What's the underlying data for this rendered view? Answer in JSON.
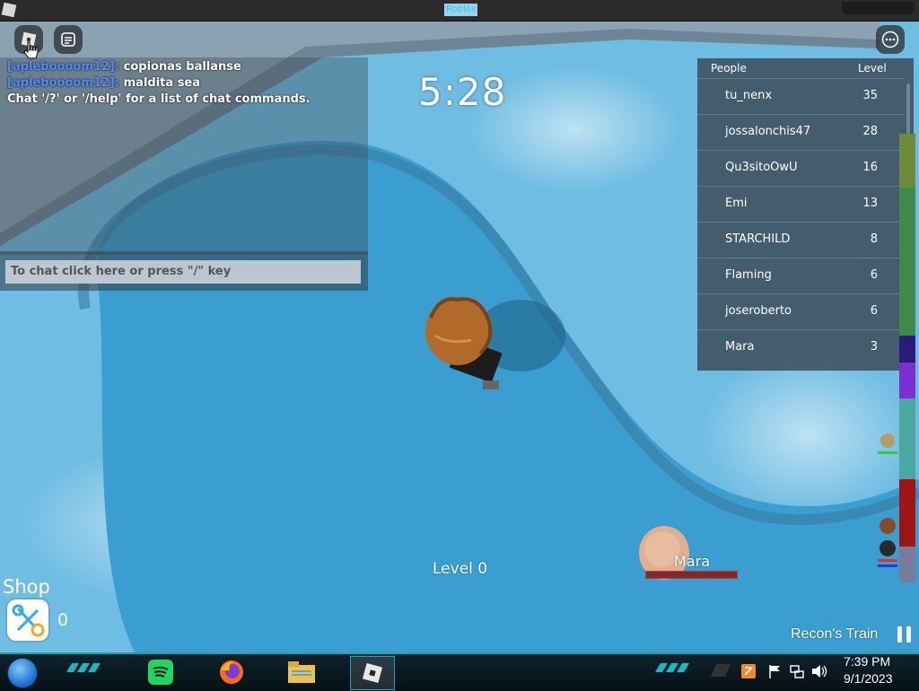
{
  "window": {
    "title": "Roblox"
  },
  "chat": {
    "messages": [
      {
        "name": "[apleboooom12]:",
        "text": "copionas ballanse"
      },
      {
        "name": "[apleboooom12]:",
        "text": "maldita sea"
      },
      {
        "name": "",
        "text": "Chat '/?' or '/help' for a list of chat commands."
      }
    ],
    "input_placeholder": "To chat click here or press \"/\" key"
  },
  "timer": "5:28",
  "leaderboard": {
    "header_people": "People",
    "header_level": "Level",
    "rows": [
      {
        "name": "tu_nenx",
        "level": "35"
      },
      {
        "name": "jossalonchis47",
        "level": "28"
      },
      {
        "name": "Qu3sitoOwU",
        "level": "16"
      },
      {
        "name": "Emi",
        "level": "13"
      },
      {
        "name": "STARCHILD",
        "level": "8"
      },
      {
        "name": "Flaming",
        "level": "6"
      },
      {
        "name": "joseroberto",
        "level": "6"
      },
      {
        "name": "Mara",
        "level": "3"
      }
    ]
  },
  "hud": {
    "level_label": "Level 0",
    "npc_name": "Mara",
    "shop_label": "Shop",
    "coins": "0",
    "train_label": "Recon's Train"
  },
  "taskbar": {
    "apps": [
      "spotify-icon",
      "firefox-icon",
      "file-explorer-icon",
      "roblox-icon"
    ],
    "time": "7:39 PM",
    "date": "9/1/2023"
  },
  "colors": {
    "water": "#5ab0dc",
    "chat_name": "#4d8bff",
    "taskbar_accent": "#1aa6b4"
  }
}
